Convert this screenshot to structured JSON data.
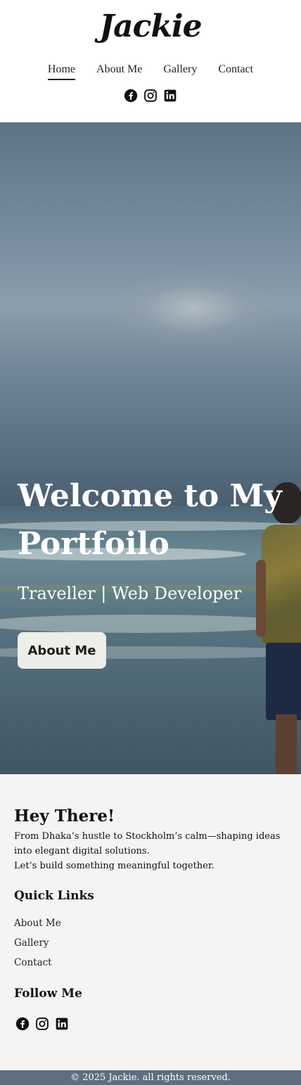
{
  "header": {
    "logo": "Jackie",
    "nav": [
      {
        "label": "Home",
        "active": true
      },
      {
        "label": "About Me",
        "active": false
      },
      {
        "label": "Gallery",
        "active": false
      },
      {
        "label": "Contact",
        "active": false
      }
    ],
    "social_icons": [
      "facebook-icon",
      "instagram-icon",
      "linkedin-icon"
    ]
  },
  "hero": {
    "title": "Welcome to My Portfoilo",
    "subtitle": "Traveller | Web Developer",
    "button_label": "About Me"
  },
  "footer": {
    "heading": "Hey There!",
    "intro_line1": "From Dhaka’s hustle to Stockholm’s calm—shaping ideas into elegant digital solutions.",
    "intro_line2": "Let’s build something meaningful together.",
    "quick_links_heading": "Quick Links",
    "quick_links": [
      "About Me",
      "Gallery",
      "Contact"
    ],
    "follow_heading": "Follow Me",
    "social_icons": [
      "facebook-icon",
      "instagram-icon",
      "linkedin-icon"
    ]
  },
  "copyright": "© 2025 Jackie. all rights reserved.",
  "colors": {
    "copyright_bar": "#5f6e7d",
    "footer_bg": "#f4f4f4",
    "hero_button_bg": "#eceee8"
  }
}
